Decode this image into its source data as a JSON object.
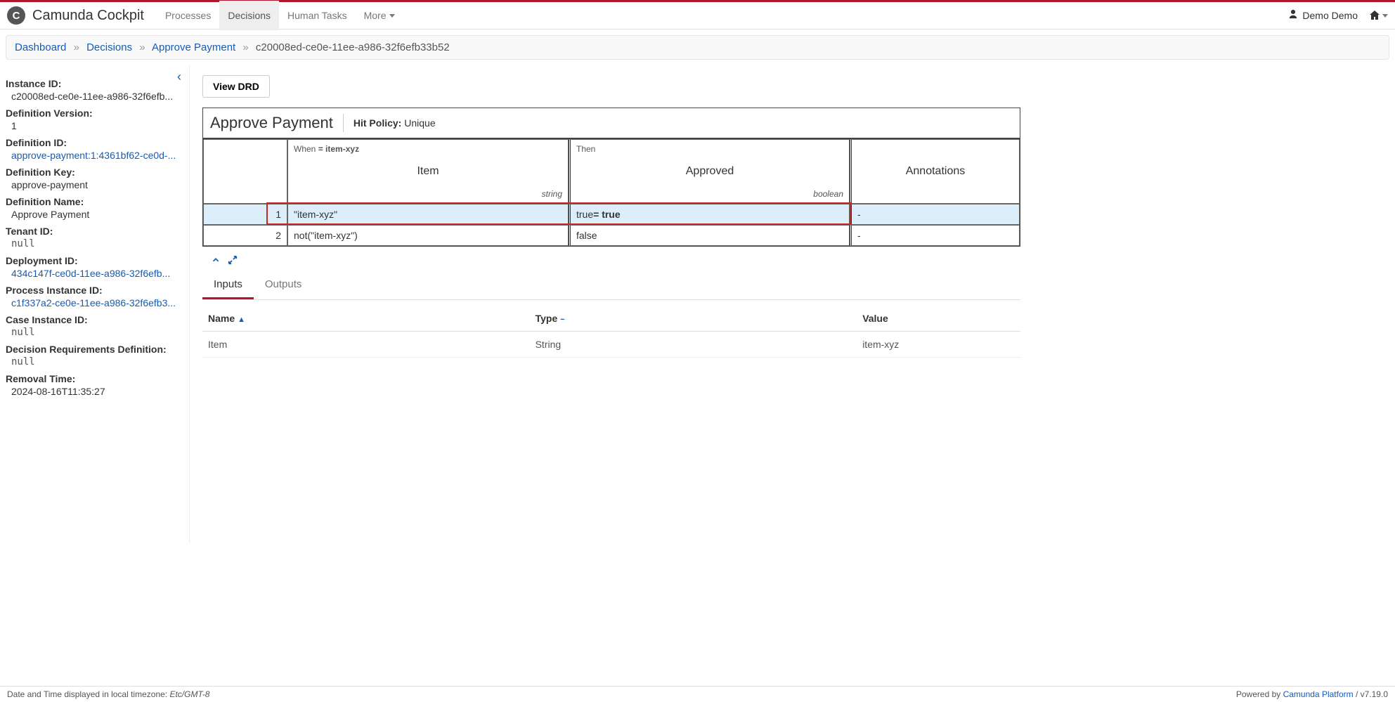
{
  "brand": {
    "logo_letter": "C",
    "title": "Camunda Cockpit"
  },
  "nav": {
    "processes": "Processes",
    "decisions": "Decisions",
    "human_tasks": "Human Tasks",
    "more": "More"
  },
  "user": {
    "name": "Demo Demo"
  },
  "breadcrumb": {
    "dashboard": "Dashboard",
    "decisions": "Decisions",
    "definition": "Approve Payment",
    "instance": "c20008ed-ce0e-11ee-a986-32f6efb33b52"
  },
  "sidebar": {
    "instance_id_lbl": "Instance ID:",
    "instance_id": "c20008ed-ce0e-11ee-a986-32f6efb...",
    "def_version_lbl": "Definition Version:",
    "def_version": "1",
    "def_id_lbl": "Definition ID:",
    "def_id": "approve-payment:1:4361bf62-ce0d-...",
    "def_key_lbl": "Definition Key:",
    "def_key": "approve-payment",
    "def_name_lbl": "Definition Name:",
    "def_name": "Approve Payment",
    "tenant_lbl": "Tenant ID:",
    "tenant": "null",
    "deployment_lbl": "Deployment ID:",
    "deployment": "434c147f-ce0d-11ee-a986-32f6efb...",
    "proc_inst_lbl": "Process Instance ID:",
    "proc_inst": "c1f337a2-ce0e-11ee-a986-32f6efb3...",
    "case_inst_lbl": "Case Instance ID:",
    "case_inst": "null",
    "drd_lbl": "Decision Requirements Definition:",
    "drd": "null",
    "removal_lbl": "Removal Time:",
    "removal": "2024-08-16T11:35:27"
  },
  "content": {
    "view_drd": "View DRD",
    "dmn": {
      "title": "Approve Payment",
      "hit_label": "Hit Policy:",
      "hit_value": "Unique",
      "when_prefix": "When",
      "when_val": "= item-xyz",
      "then": "Then",
      "input_col": "Item",
      "input_type": "string",
      "output_col": "Approved",
      "output_type": "boolean",
      "annot_col": "Annotations",
      "rules": [
        {
          "idx": "1",
          "input": "\"item-xyz\"",
          "out_pre": "true ",
          "out_bold": "= true",
          "annot": "-"
        },
        {
          "idx": "2",
          "input": "not(\"item-xyz\")",
          "out_pre": "false",
          "out_bold": "",
          "annot": "-"
        }
      ]
    },
    "tabs": {
      "inputs": "Inputs",
      "outputs": "Outputs"
    },
    "io_head": {
      "name": "Name",
      "type": "Type",
      "value": "Value"
    },
    "io_rows": [
      {
        "name": "Item",
        "type": "String",
        "value": "item-xyz"
      }
    ]
  },
  "footer": {
    "tz_label": "Date and Time displayed in local timezone: ",
    "tz": "Etc/GMT-8",
    "powered": "Powered by ",
    "platform": "Camunda Platform",
    "version": " / v7.19.0"
  }
}
